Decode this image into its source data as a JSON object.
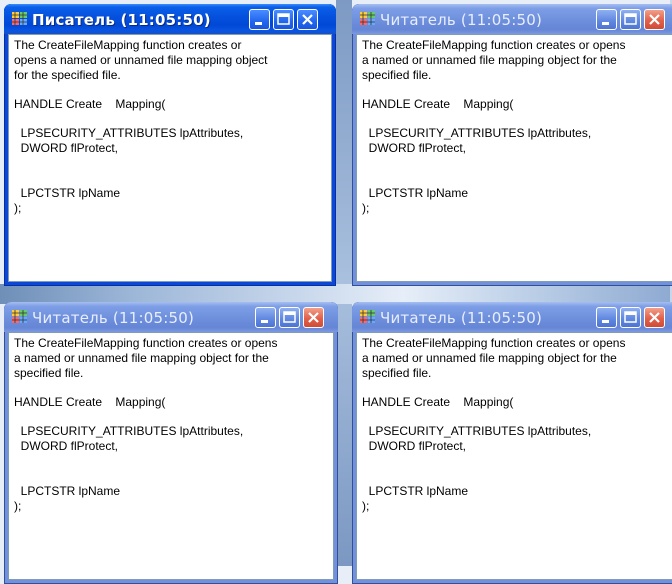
{
  "windows": [
    {
      "title": "Писатель (11:05:50)",
      "active": true,
      "content": {
        "description": [
          "The CreateFileMapping function creates or",
          "opens a named or unnamed file mapping object",
          "for the specified file."
        ],
        "signature": "HANDLE Create    Mapping(",
        "params": [
          "  LPSECURITY_ATTRIBUTES lpAttributes,",
          "  DWORD flProtect,"
        ],
        "name_param": "  LPCTSTR lpName",
        "closing": ");"
      }
    },
    {
      "title": "Читатель (11:05:50)",
      "active": false,
      "content": {
        "description": [
          "The CreateFileMapping function creates or opens",
          "a named or unnamed file mapping object for the",
          "specified file."
        ],
        "signature": "HANDLE Create    Mapping(",
        "params": [
          "  LPSECURITY_ATTRIBUTES lpAttributes,",
          "  DWORD flProtect,"
        ],
        "name_param": "  LPCTSTR lpName",
        "closing": ");"
      }
    },
    {
      "title": "Читатель (11:05:50)",
      "active": false,
      "content": {
        "description": [
          "The CreateFileMapping function creates or opens",
          "a named or unnamed file mapping object for the",
          "specified file."
        ],
        "signature": "HANDLE Create    Mapping(",
        "params": [
          "  LPSECURITY_ATTRIBUTES lpAttributes,",
          "  DWORD flProtect,"
        ],
        "name_param": "  LPCTSTR lpName",
        "closing": ");"
      }
    },
    {
      "title": "Читатель (11:05:50)",
      "active": false,
      "content": {
        "description": [
          "The CreateFileMapping function creates or opens",
          "a named or unnamed file mapping object for the",
          "specified file."
        ],
        "signature": "HANDLE Create    Mapping(",
        "params": [
          "  LPSECURITY_ATTRIBUTES lpAttributes,",
          "  DWORD flProtect,"
        ],
        "name_param": "  LPCTSTR lpName",
        "closing": ");"
      }
    }
  ],
  "icons": {
    "app": "app-window-icon",
    "minimize": "minimize-icon",
    "maximize": "maximize-icon",
    "close": "close-icon"
  },
  "colors": {
    "active_title": "#0048d6",
    "inactive_title": "#7391d8",
    "close_button": "#e2604a"
  }
}
